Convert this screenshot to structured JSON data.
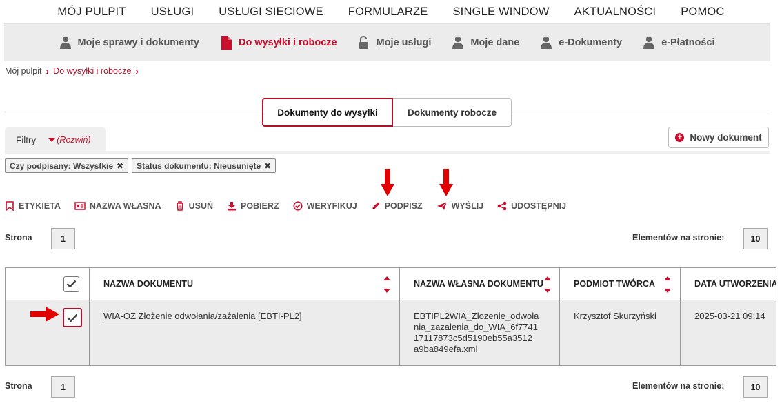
{
  "top_nav": [
    {
      "label": "MÓJ PULPIT"
    },
    {
      "label": "USŁUGI"
    },
    {
      "label": "USŁUGI SIECIOWE"
    },
    {
      "label": "FORMULARZE"
    },
    {
      "label": "SINGLE WINDOW"
    },
    {
      "label": "AKTUALNOŚCI"
    },
    {
      "label": "POMOC"
    }
  ],
  "sub_nav": [
    {
      "label": "Moje sprawy i dokumenty",
      "icon": "user-icon"
    },
    {
      "label": "Do wysyłki i robocze",
      "icon": "document-icon",
      "active": true
    },
    {
      "label": "Moje usługi",
      "icon": "unlock-icon"
    },
    {
      "label": "Moje dane",
      "icon": "user-icon"
    },
    {
      "label": "e-Dokumenty",
      "icon": "user-icon"
    },
    {
      "label": "e-Płatności",
      "icon": "user-icon"
    }
  ],
  "breadcrumb": {
    "home": "Mój pulpit",
    "current": "Do wysyłki i robocze"
  },
  "tabs": {
    "active": "Dokumenty do wysyłki",
    "inactive": "Dokumenty robocze"
  },
  "filters": {
    "label": "Filtry",
    "toggle": "(Rozwiń)"
  },
  "new_document_label": "Nowy dokument",
  "chips": [
    {
      "label": "Czy podpisany: Wszystkie"
    },
    {
      "label": "Status dokumentu: Nieusunięte"
    }
  ],
  "actions": [
    {
      "label": "ETYKIETA",
      "icon": "bookmark-icon"
    },
    {
      "label": "NAZWA WŁASNA",
      "icon": "id-card-icon"
    },
    {
      "label": "USUŃ",
      "icon": "trash-icon"
    },
    {
      "label": "POBIERZ",
      "icon": "download-icon"
    },
    {
      "label": "WERYFIKUJ",
      "icon": "check-circle-icon"
    },
    {
      "label": "PODPISZ",
      "icon": "pencil-icon"
    },
    {
      "label": "WYŚLIJ",
      "icon": "send-icon"
    },
    {
      "label": "UDOSTĘPNIJ",
      "icon": "share-icon"
    }
  ],
  "pager": {
    "page_label": "Strona",
    "page": "1",
    "per_page_label": "Elementów na stronie:",
    "per_page": "10"
  },
  "table": {
    "headers": {
      "name": "NAZWA DOKUMENTU",
      "own_name": "NAZWA WŁASNA DOKUMENTU",
      "creator": "PODMIOT TWÓRCA",
      "created": "DATA UTWORZENIA"
    },
    "rows": [
      {
        "name": "WIA-OZ Złożenie odwołania/zażalenia [EBTI-PL2]",
        "own_name": "EBTIPL2WIA_Zlozenie_odwola nia_zazalenia_do_WIA_6f7741 17117873c5d5190eb55a3512 a9ba849efa.xml",
        "creator": "Krzysztof Skurzyński",
        "created": "2025-03-21 09:14"
      }
    ]
  },
  "colors": {
    "accent": "#c8102e",
    "annotation_arrow": "#e00000"
  }
}
